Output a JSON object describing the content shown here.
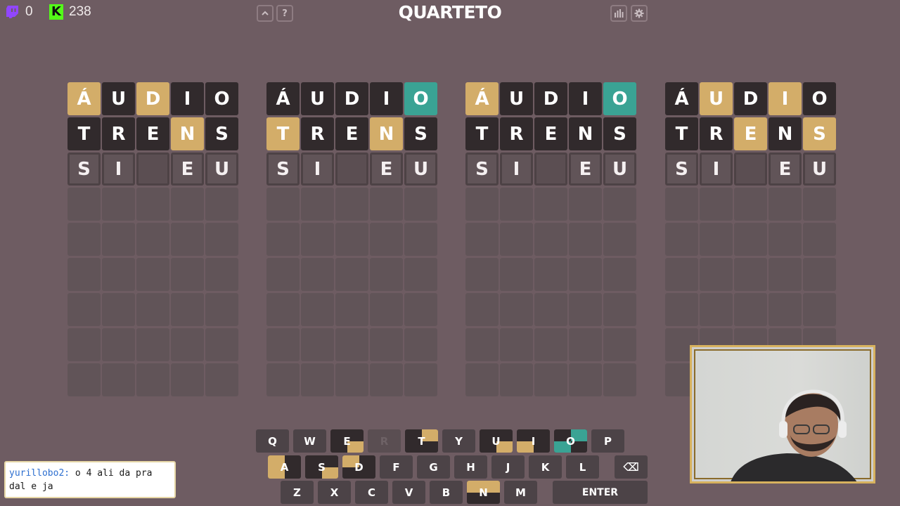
{
  "header": {
    "twitch_count": "0",
    "kick_count": "238",
    "title": "QUARTETO",
    "left_buttons": [
      {
        "icon": "chevron-up-icon",
        "glyph": "^"
      },
      {
        "icon": "help-icon",
        "glyph": "?"
      }
    ],
    "right_buttons": [
      {
        "icon": "stats-icon",
        "glyph": "📊"
      },
      {
        "icon": "gear-icon",
        "glyph": "⚙"
      }
    ]
  },
  "colors": {
    "background": "#6e5c62",
    "correct": "#3aa394",
    "present": "#d3ad69",
    "absent": "#312a2c",
    "kick": "#53fc18",
    "twitch": "#9146ff"
  },
  "boards": [
    {
      "rows": [
        {
          "letters": [
            "Á",
            "U",
            "D",
            "I",
            "O"
          ],
          "states": [
            "yellow",
            "black",
            "yellow",
            "black",
            "black"
          ]
        },
        {
          "letters": [
            "T",
            "R",
            "E",
            "N",
            "S"
          ],
          "states": [
            "black",
            "black",
            "black",
            "yellow",
            "black"
          ]
        },
        {
          "letters": [
            "S",
            "I",
            "",
            "E",
            "U"
          ],
          "states": [
            "input",
            "input",
            "input",
            "input",
            "input"
          ]
        }
      ]
    },
    {
      "rows": [
        {
          "letters": [
            "Á",
            "U",
            "D",
            "I",
            "O"
          ],
          "states": [
            "black",
            "black",
            "black",
            "black",
            "green"
          ]
        },
        {
          "letters": [
            "T",
            "R",
            "E",
            "N",
            "S"
          ],
          "states": [
            "yellow",
            "black",
            "black",
            "yellow",
            "black"
          ]
        },
        {
          "letters": [
            "S",
            "I",
            "",
            "E",
            "U"
          ],
          "states": [
            "input",
            "input",
            "input",
            "input",
            "input"
          ]
        }
      ]
    },
    {
      "rows": [
        {
          "letters": [
            "Á",
            "U",
            "D",
            "I",
            "O"
          ],
          "states": [
            "yellow",
            "black",
            "black",
            "black",
            "green"
          ]
        },
        {
          "letters": [
            "T",
            "R",
            "E",
            "N",
            "S"
          ],
          "states": [
            "black",
            "black",
            "black",
            "black",
            "black"
          ]
        },
        {
          "letters": [
            "S",
            "I",
            "",
            "E",
            "U"
          ],
          "states": [
            "input",
            "input",
            "input",
            "input",
            "input"
          ]
        }
      ]
    },
    {
      "rows": [
        {
          "letters": [
            "Á",
            "U",
            "D",
            "I",
            "O"
          ],
          "states": [
            "black",
            "yellow",
            "black",
            "yellow",
            "black"
          ]
        },
        {
          "letters": [
            "T",
            "R",
            "E",
            "N",
            "S"
          ],
          "states": [
            "black",
            "black",
            "yellow",
            "black",
            "yellow"
          ]
        },
        {
          "letters": [
            "S",
            "I",
            "",
            "E",
            "U"
          ],
          "states": [
            "input",
            "input",
            "input",
            "input",
            "input"
          ]
        }
      ]
    }
  ],
  "keyboard": {
    "rows": [
      [
        {
          "label": "Q",
          "state": "none"
        },
        {
          "label": "W",
          "state": "none"
        },
        {
          "label": "E",
          "state": "black",
          "marks": {
            "br": "yellow"
          }
        },
        {
          "label": "R",
          "state": "dim"
        },
        {
          "label": "T",
          "state": "black",
          "marks": {
            "tr": "yellow"
          }
        },
        {
          "label": "Y",
          "state": "none"
        },
        {
          "label": "U",
          "state": "black",
          "marks": {
            "br": "yellow"
          }
        },
        {
          "label": "I",
          "state": "black",
          "marks": {
            "bl": "yellow"
          }
        },
        {
          "label": "O",
          "state": "black",
          "marks": {
            "tr": "green",
            "bl": "green"
          }
        },
        {
          "label": "P",
          "state": "none"
        }
      ],
      [
        {
          "label": "A",
          "state": "black",
          "marks": {
            "tl": "yellow",
            "bl": "yellow"
          }
        },
        {
          "label": "S",
          "state": "black",
          "marks": {
            "br": "yellow"
          }
        },
        {
          "label": "D",
          "state": "black",
          "marks": {
            "tl": "yellow"
          }
        },
        {
          "label": "F",
          "state": "none"
        },
        {
          "label": "G",
          "state": "none"
        },
        {
          "label": "H",
          "state": "none"
        },
        {
          "label": "J",
          "state": "none"
        },
        {
          "label": "K",
          "state": "none"
        },
        {
          "label": "L",
          "state": "none"
        },
        {
          "label": "⌫",
          "state": "none",
          "wide": true,
          "icon": "backspace-icon"
        }
      ],
      [
        {
          "label": "Z",
          "state": "none"
        },
        {
          "label": "X",
          "state": "none"
        },
        {
          "label": "C",
          "state": "none"
        },
        {
          "label": "V",
          "state": "none"
        },
        {
          "label": "B",
          "state": "none"
        },
        {
          "label": "N",
          "state": "black",
          "marks": {
            "tl": "yellow",
            "tr": "yellow"
          }
        },
        {
          "label": "M",
          "state": "none"
        },
        {
          "label": "ENTER",
          "state": "none",
          "wide": true
        }
      ]
    ]
  },
  "chat": {
    "username": "yurillobo2:",
    "message": "o 4 ali da pra dal e ja"
  }
}
